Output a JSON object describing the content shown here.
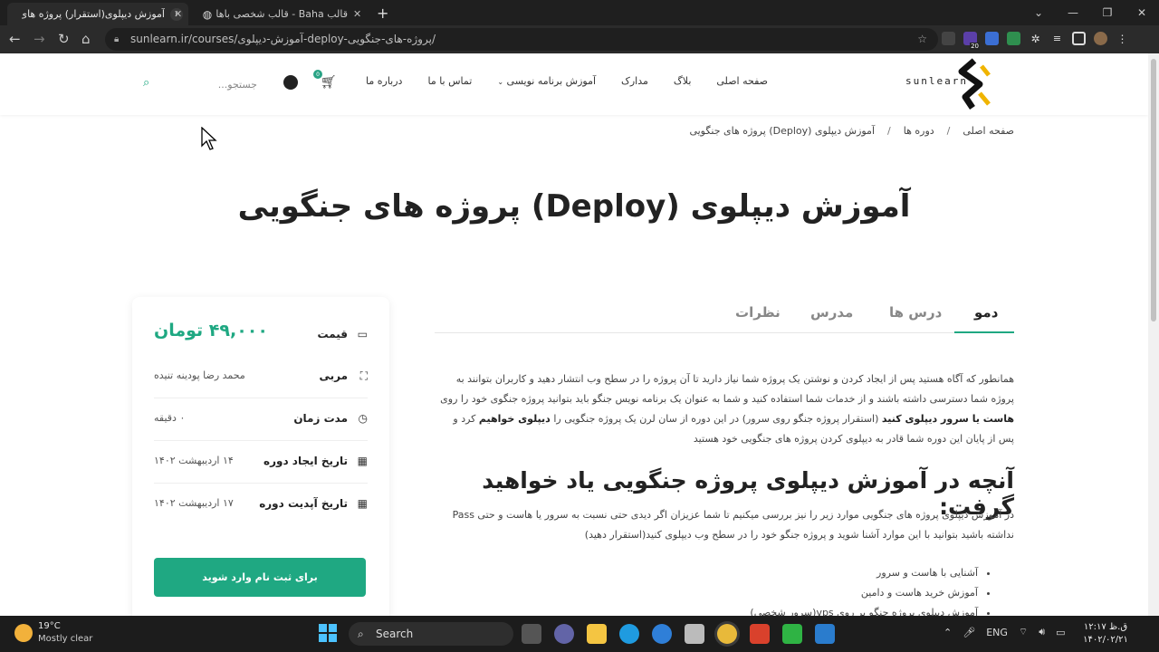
{
  "browser": {
    "tabs": [
      {
        "title": "آموزش دیپلوی(استقرار) پروژه های ج",
        "active": true
      },
      {
        "title": "قالب Baha - قالب شخصی باها",
        "active": false
      }
    ],
    "url": "sunlearn.ir/courses/آموزش-دیپلوی-deploy-پروژه-های-جنگویی/",
    "extension_badge": "20"
  },
  "header": {
    "logo_text": "sunlearn",
    "nav": [
      "صفحه اصلی",
      "بلاگ",
      "مدارک",
      "آموزش برنامه نویسی",
      "تماس با ما",
      "درباره ما"
    ],
    "cart_count": "0",
    "search_placeholder": "جستجو..."
  },
  "breadcrumb": [
    "صفحه اصلی",
    "دوره ها",
    "آموزش دیپلوی (Deploy) پروژه های جنگویی"
  ],
  "page_title": "آموزش دیپلوی (Deploy) پروژه های جنگویی",
  "sidebar": {
    "price_label": "قیمت",
    "price_value": "۴۹,۰۰۰ تومان",
    "instructor_label": "مربی",
    "instructor_value": "محمد رضا پودینه تنیده",
    "duration_label": "مدت زمان",
    "duration_value": "۰ دقیقه",
    "created_label": "تاریخ ایجاد دوره",
    "created_value": "۱۴ اردیبهشت ۱۴۰۲",
    "updated_label": "تاریخ آپدیت دوره",
    "updated_value": "۱۷ اردیبهشت ۱۴۰۲",
    "enroll_button": "برای ثبت نام وارد شوید"
  },
  "content_tabs": [
    "دمو",
    "درس ها",
    "مدرس",
    "نظرات"
  ],
  "description": {
    "p1": "همانطور که آگاه هستید پس از ایجاد کردن و نوشتن یک پروژه شما نیاز دارید تا آن پروژه را در سطح وب انتشار دهید و کاربران بتوانند به پروژه شما دسترسی داشته باشند و از خدمات شما استفاده کنید و شما به عنوان یک برنامه نویس جنگو باید بتوانید پروژه جنگوی خود را روی",
    "b1": "هاست یا سرور دیپلوی کنید",
    "p2": "(استقرار پروژه جنگو روی سرور) در این دوره از سان لرن یک پروژه جنگویی را",
    "b2": "دیپلوی خواهیم",
    "p3": "کرد و پس از پایان این دوره شما قادر به دیپلوی کردن پروژه های جنگویی خود هستید"
  },
  "section": {
    "title": "آنچه در آموزش دیپلوی پروژه جنگویی یاد خواهید گرفت:",
    "text": "در آموزش دیپلوی پروژه های جنگویی موارد زیر را نیز بررسی میکنیم تا شما عزیزان اگر دیدی حتی نسبت به سرور یا هاست و حتی Pass نداشته باشید بتوانید با این موارد آشنا شوید و پروژه جنگو خود را در سطح وب دیپلوی کنید(استقرار دهید)",
    "bullets": [
      "آشنایی با هاست و سرور",
      "آموزش خرید هاست  و دامین",
      "آموزش دیپلوی پروژه جنگو بر روی vps(سرور شخصی)"
    ]
  },
  "taskbar": {
    "temp": "19°C",
    "weather": "Mostly clear",
    "search": "Search",
    "lang": "ENG",
    "time": "۱۲:۱۷ ق.ظ",
    "date": "۱۴۰۲/۰۲/۲۱"
  }
}
